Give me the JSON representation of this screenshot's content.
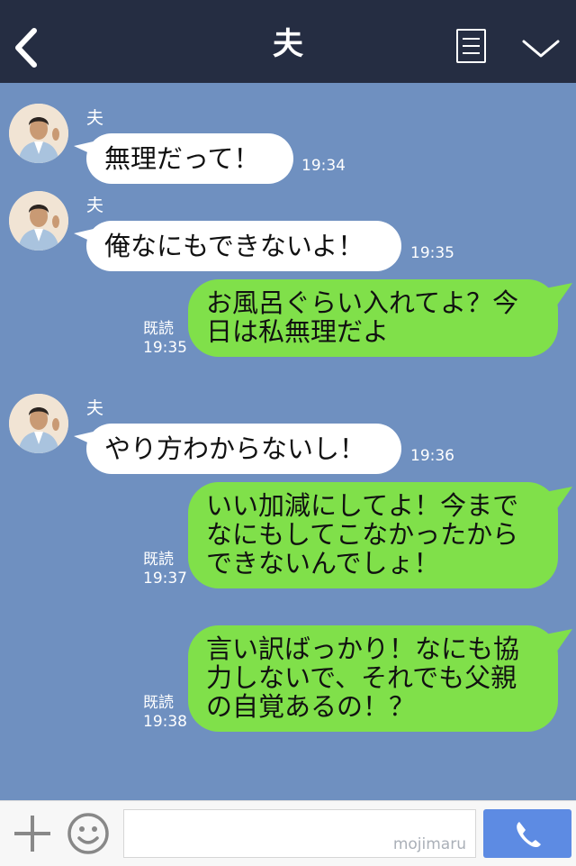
{
  "header": {
    "title": "夫"
  },
  "messages": [
    {
      "sender": "夫",
      "text": "無理だって！",
      "time": "19:34"
    },
    {
      "sender": "夫",
      "text": "俺なにもできないよ！",
      "time": "19:35"
    },
    {
      "line1": "お風呂ぐらい入れてよ？今",
      "line2": "日は私無理だよ",
      "read": "既読",
      "time": "19:35"
    },
    {
      "sender": "夫",
      "text": "やり方わからないし！",
      "time": "19:36"
    },
    {
      "line1": "いい加減にしてよ！今まで",
      "line2": "なにもしてこなかったから",
      "line3": "できないんでしょ！",
      "read": "既読",
      "time": "19:37"
    },
    {
      "line1": "言い訳ばっかり！なにも協",
      "line2": "力しないで、それでも父親",
      "line3": "の自覚あるの！？",
      "read": "既読",
      "time": "19:38"
    }
  ],
  "input": {
    "watermark": "mojimaru"
  },
  "colors": {
    "header_bg": "#252d42",
    "chat_bg": "#6f90c0",
    "outgoing_bubble": "#80e04a",
    "incoming_bubble": "#ffffff",
    "call_button": "#5d8be3"
  },
  "icons": [
    "back-arrow-icon",
    "menu-icon",
    "chevron-down-icon",
    "plus-icon",
    "emoji-icon",
    "phone-icon"
  ]
}
